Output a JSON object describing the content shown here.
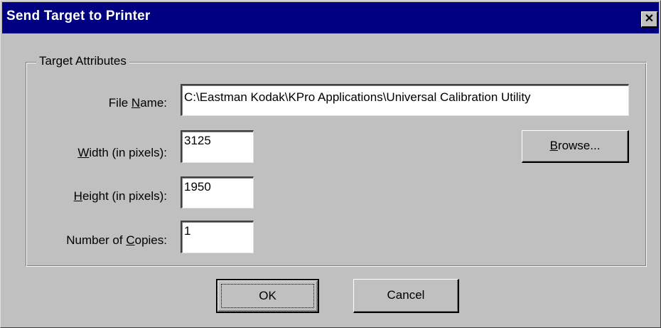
{
  "window": {
    "title": "Send Target to Printer",
    "close_glyph": "✕"
  },
  "group": {
    "legend": "Target Attributes"
  },
  "fields": {
    "file_name": {
      "label_pre": "File ",
      "label_accel": "N",
      "label_post": "ame:",
      "value": "C:\\Eastman Kodak\\KPro Applications\\Universal Calibration Utility"
    },
    "width": {
      "label_pre": "",
      "label_accel": "W",
      "label_post": "idth (in pixels):",
      "value": "3125"
    },
    "height": {
      "label_pre": "",
      "label_accel": "H",
      "label_post": "eight (in pixels):",
      "value": "1950"
    },
    "copies": {
      "label_pre": "Number of ",
      "label_accel": "C",
      "label_post": "opies:",
      "value": "1"
    }
  },
  "buttons": {
    "browse_accel": "B",
    "browse_post": "rowse...",
    "ok": "OK",
    "cancel": "Cancel"
  },
  "colors": {
    "titlebar": "#000080",
    "face": "#c0c0c0"
  },
  "icons": {
    "close": "close-icon"
  }
}
